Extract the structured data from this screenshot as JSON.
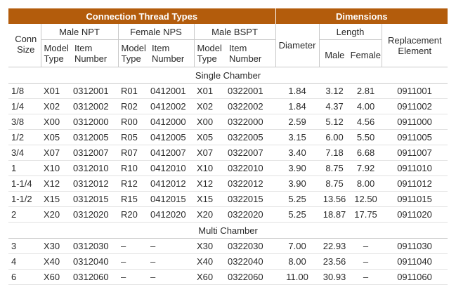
{
  "header": {
    "group_thread": "Connection Thread Types",
    "group_dims": "Dimensions"
  },
  "subheader": {
    "conn_size": [
      "Conn",
      "Size"
    ],
    "male_npt": "Male NPT",
    "female_nps": "Female NPS",
    "male_bspt": "Male BSPT",
    "diameter": "Diameter",
    "length": "Length",
    "replacement": [
      "Replacement",
      "Element"
    ],
    "model_type": [
      "Model",
      "Type"
    ],
    "item_number": [
      "Item",
      "Number"
    ],
    "male": "Male",
    "female": "Female"
  },
  "sections": [
    {
      "title": "Single Chamber",
      "rows": [
        [
          "1/8",
          "X01",
          "0312001",
          "R01",
          "0412001",
          "X01",
          "0322001",
          "1.84",
          "3.12",
          "2.81",
          "0911001"
        ],
        [
          "1/4",
          "X02",
          "0312002",
          "R02",
          "0412002",
          "X02",
          "0322002",
          "1.84",
          "4.37",
          "4.00",
          "0911002"
        ],
        [
          "3/8",
          "X00",
          "0312000",
          "R00",
          "0412000",
          "X00",
          "0322000",
          "2.59",
          "5.12",
          "4.56",
          "0911000"
        ],
        [
          "1/2",
          "X05",
          "0312005",
          "R05",
          "0412005",
          "X05",
          "0322005",
          "3.15",
          "6.00",
          "5.50",
          "0911005"
        ],
        [
          "3/4",
          "X07",
          "0312007",
          "R07",
          "0412007",
          "X07",
          "0322007",
          "3.40",
          "7.18",
          "6.68",
          "0911007"
        ],
        [
          "1",
          "X10",
          "0312010",
          "R10",
          "0412010",
          "X10",
          "0322010",
          "3.90",
          "8.75",
          "7.92",
          "0911010"
        ],
        [
          "1-1/4",
          "X12",
          "0312012",
          "R12",
          "0412012",
          "X12",
          "0322012",
          "3.90",
          "8.75",
          "8.00",
          "0911012"
        ],
        [
          "1-1/2",
          "X15",
          "0312015",
          "R15",
          "0412015",
          "X15",
          "0322015",
          "5.25",
          "13.56",
          "12.50",
          "0911015"
        ],
        [
          "2",
          "X20",
          "0312020",
          "R20",
          "0412020",
          "X20",
          "0322020",
          "5.25",
          "18.87",
          "17.75",
          "0911020"
        ]
      ]
    },
    {
      "title": "Multi Chamber",
      "rows": [
        [
          "3",
          "X30",
          "0312030",
          "–",
          "–",
          "X30",
          "0322030",
          "7.00",
          "22.93",
          "–",
          "0911030"
        ],
        [
          "4",
          "X40",
          "0312040",
          "–",
          "–",
          "X40",
          "0322040",
          "8.00",
          "23.56",
          "–",
          "0911040"
        ],
        [
          "6",
          "X60",
          "0312060",
          "–",
          "–",
          "X60",
          "0322060",
          "11.00",
          "30.93",
          "–",
          "0911060"
        ]
      ]
    }
  ]
}
